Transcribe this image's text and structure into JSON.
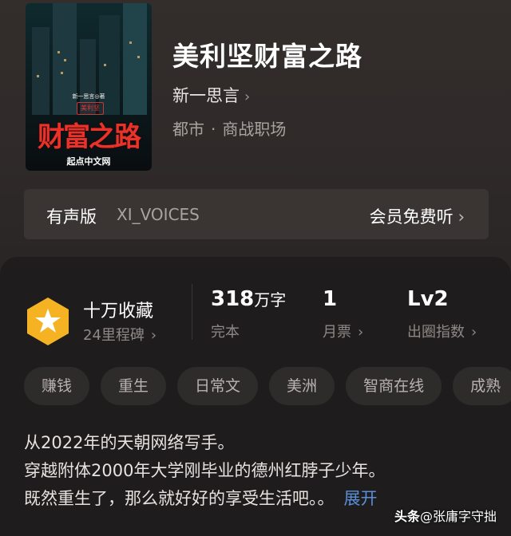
{
  "book": {
    "title": "美利坚财富之路",
    "author": "新一思言",
    "genre": "都市",
    "subgenre": "商战职场",
    "cover": {
      "line1": "新一思言◎著",
      "badge": "美利坚",
      "title": "财富之路",
      "publisher": "起点中文网"
    }
  },
  "audio": {
    "label": "有声版",
    "voice": "XI_VOICES",
    "free_label": "会员免费听"
  },
  "stats": {
    "favorites": "十万收藏",
    "milestones": "24里程碑",
    "words_value": "318",
    "words_unit": "万字",
    "words_label": "完本",
    "tickets_value": "1",
    "tickets_label": "月票",
    "level_value": "Lv2",
    "level_label": "出圈指数"
  },
  "tags": [
    "赚钱",
    "重生",
    "日常文",
    "美洲",
    "智商在线",
    "成熟"
  ],
  "description": {
    "line1": "从2022年的天朝网络写手。",
    "line2": "穿越附体2000年大学刚毕业的德州红脖子少年。",
    "line3": "既然重生了，那么就好好的享受生活吧。。",
    "expand": "展开"
  },
  "watermark": {
    "brand": "头条",
    "author": "@张庸字守拙"
  },
  "colors": {
    "accent_link": "#5b8fd8",
    "badge_gold": "#f5b324",
    "cover_title": "#e8322a"
  }
}
